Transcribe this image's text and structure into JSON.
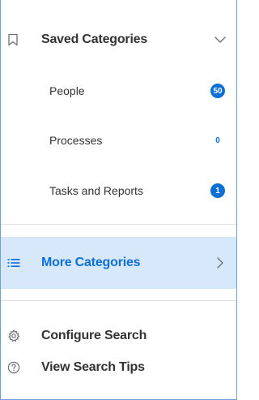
{
  "saved_categories": {
    "title": "Saved Categories",
    "icon": "bookmark-icon",
    "chevron": "chevron-down-icon",
    "items": [
      {
        "label": "People",
        "count": "50",
        "badge_style": "filled"
      },
      {
        "label": "Processes",
        "count": "0",
        "badge_style": "plain"
      },
      {
        "label": "Tasks and Reports",
        "count": "1",
        "badge_style": "filled"
      }
    ]
  },
  "more_categories": {
    "title": "More Categories",
    "icon": "list-icon",
    "chevron": "chevron-right-icon"
  },
  "configure_search": {
    "title": "Configure Search",
    "icon": "gear-icon"
  },
  "view_search_tips": {
    "title": "View Search Tips",
    "icon": "help-circle-icon"
  },
  "colors": {
    "accent": "#0b6fd6",
    "highlight_bg": "#d7e8fb",
    "text": "#333333",
    "divider": "#e0e3e6",
    "border": "#6f9fd8"
  }
}
